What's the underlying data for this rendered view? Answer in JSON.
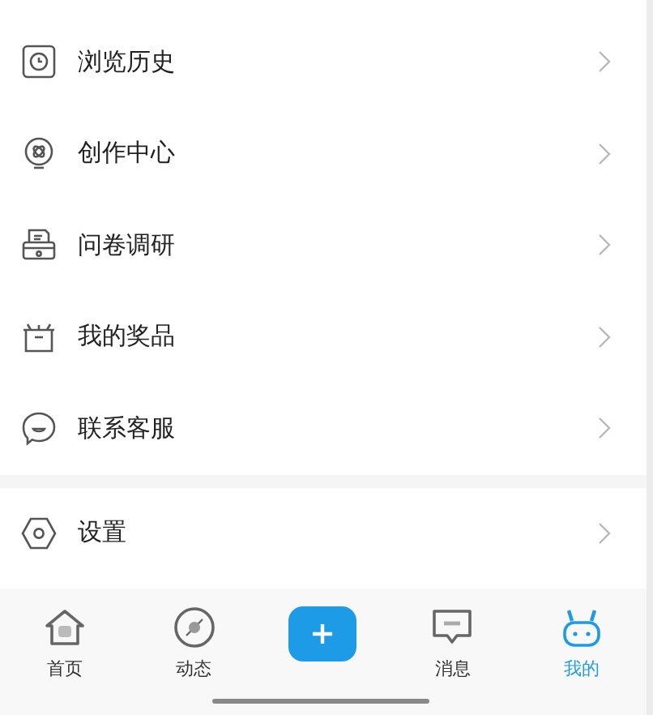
{
  "menu_groups": [
    {
      "items": [
        {
          "label": "浏览历史"
        },
        {
          "label": "创作中心"
        },
        {
          "label": "问卷调研"
        },
        {
          "label": "我的奖品"
        },
        {
          "label": "联系客服"
        }
      ]
    },
    {
      "items": [
        {
          "label": "设置"
        }
      ]
    }
  ],
  "tab_bar": [
    {
      "kind": "tab",
      "label": "首页",
      "selected": false
    },
    {
      "kind": "tab",
      "label": "动态",
      "selected": false
    },
    {
      "kind": "publish"
    },
    {
      "kind": "tab",
      "label": "消息",
      "selected": false
    },
    {
      "kind": "tab",
      "label": "我的",
      "selected": true
    }
  ]
}
